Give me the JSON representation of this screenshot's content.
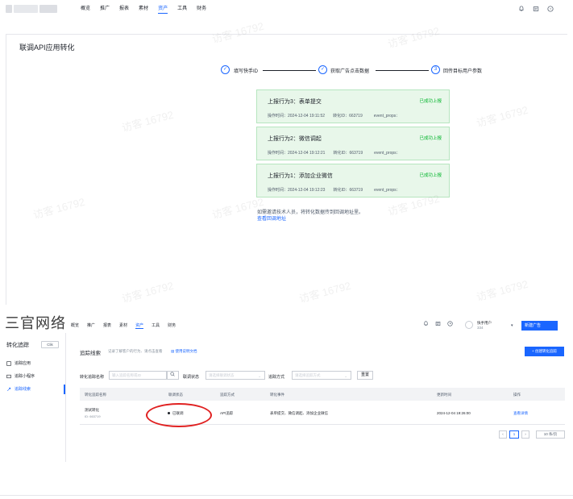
{
  "top_nav": {
    "items": [
      "概览",
      "推广",
      "报表",
      "素材",
      "资产",
      "工具",
      "财务"
    ],
    "active": "资产"
  },
  "top_icons": [
    "bell-icon",
    "message-icon",
    "help-icon"
  ],
  "page_title": "联调API应用转化",
  "steps": [
    {
      "mark": "✓",
      "label": "填写快手ID"
    },
    {
      "mark": "✓",
      "label": "获取广告点击数据"
    },
    {
      "mark": "3",
      "label": "回传目标用户参数"
    }
  ],
  "cards": [
    {
      "title": "上报行为3：表单提交",
      "status": "已成功上报",
      "time": "操作时间：2024-12-04 19:11:52",
      "id": "转化ID：663719",
      "props": "event_props："
    },
    {
      "title": "上报行为2：微信调起",
      "status": "已成功上报",
      "time": "操作时间：2024-12-04 19:12:21",
      "id": "转化ID：663719",
      "props": "event_props："
    },
    {
      "title": "上报行为1：添加企业微信",
      "status": "已成功上报",
      "time": "操作时间：2024-12-04 19:12:23",
      "id": "转化ID：663719",
      "props": "event_props："
    }
  ],
  "note": "如需邀请技术人员，将转化数据传到回调地址里。",
  "note_link": "查看回调地址",
  "watermark": "访客 16792",
  "brand": "三官网络",
  "bottom_nav": {
    "items": [
      "概览",
      "推广",
      "报表",
      "素材",
      "资产",
      "工具",
      "财务"
    ],
    "active": "资产"
  },
  "bottom_icons": [
    "bell-icon",
    "message-icon",
    "clock-icon"
  ],
  "user": {
    "name": "快手用户",
    "id": "334"
  },
  "new_ad": "新建广告",
  "sidebar": {
    "title": "转化追踪",
    "tag": "Clik",
    "items": [
      {
        "icon": "app-icon",
        "label": "追踪应用"
      },
      {
        "icon": "mini-program-icon",
        "label": "追踪小程序"
      },
      {
        "icon": "link-icon",
        "label": "追踪线索"
      }
    ],
    "active": "追踪线索"
  },
  "main": {
    "title": "追踪线索",
    "hint": "记录了解客户的行为、请点击查看",
    "doc_link": "使用说明文档",
    "create_button": "+ 创建转化追踪"
  },
  "filters": {
    "name_label": "转化追踪名称",
    "name_placeholder": "输入追踪名称或ID",
    "status_label": "联调状态",
    "status_placeholder": "请选择联调状态",
    "method_label": "追踪方式",
    "method_placeholder": "请选择追踪方式",
    "reset": "重置"
  },
  "table": {
    "headers": [
      "转化追踪名称",
      "联调状态",
      "追踪方式",
      "转化事件",
      "更新时间",
      "操作"
    ],
    "rows": [
      {
        "name": "测试转化",
        "id": "ID: 663719",
        "status": "已联调",
        "method": "API追踪",
        "events": "表单提交、微信调起、添加企业微信",
        "updated": "2024-12-04 19:26:00",
        "action": "查看详情"
      }
    ]
  },
  "pager": {
    "page": "1",
    "size": "10 条/页"
  }
}
